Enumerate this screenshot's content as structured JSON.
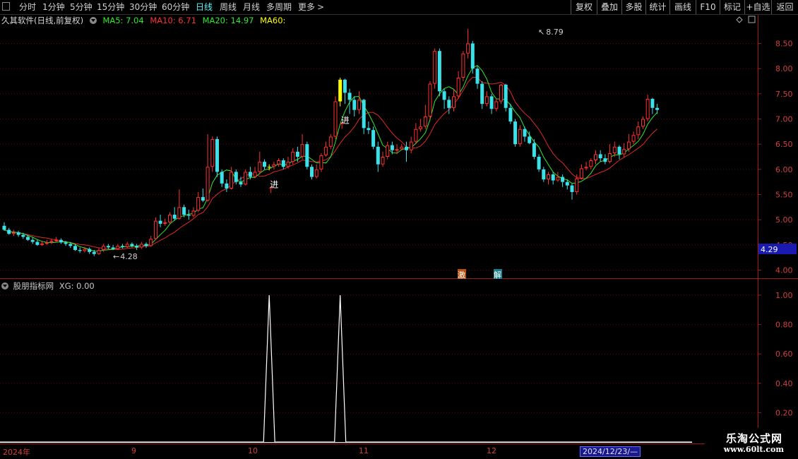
{
  "topbar": {
    "menu_items": [
      "分时",
      "1分钟",
      "5分钟",
      "15分钟",
      "30分钟",
      "60分钟",
      "日线",
      "周线",
      "月线",
      "多周期",
      "更多"
    ],
    "active": "日线",
    "more_arrow": ">",
    "right_buttons": [
      "复权",
      "叠加",
      "多股",
      "统计",
      "画线",
      "F10",
      "标记",
      "+自选",
      "返回"
    ]
  },
  "header": {
    "title": "久其软件(日线,前复权)",
    "ma5": "MA5: 7.04",
    "ma10": "MA10: 6.71",
    "ma20": "MA20: 14.97",
    "ma60": "MA60:",
    "colors": {
      "ma5": "#2ee82e",
      "ma10": "#ff3030",
      "ma20": "#2ee82e",
      "ma60": "#ffff00"
    }
  },
  "indicator": {
    "title": "股朋指标网",
    "value": "XG: 0.00"
  },
  "price_axis": {
    "ticks": [
      "8.50",
      "8.00",
      "7.50",
      "7.00",
      "6.50",
      "6.00",
      "5.50",
      "5.00",
      "4.50",
      "4.00"
    ],
    "current": "4.29"
  },
  "indicator_axis": {
    "ticks": [
      "1.00",
      "0.80",
      "0.60",
      "0.40",
      "0.20"
    ]
  },
  "annotations": {
    "high_label": "8.79",
    "low_label": "4.28",
    "signal_char": "进",
    "event1": "激",
    "event2": "解"
  },
  "time_axis": {
    "labels": [
      "2024年",
      "9",
      "10",
      "11",
      "12"
    ],
    "cursor_date": "2024/12/23/—"
  },
  "watermark": {
    "title": "乐淘公式网",
    "url": "www.60lt.com"
  },
  "chart_data": {
    "type": "candlestick",
    "ylim": [
      3.8,
      8.9
    ],
    "colors": {
      "up": "#ff3030",
      "down": "#3be0e8",
      "signal_bar": "#ffff00"
    },
    "candles": [
      [
        4.88,
        4.8,
        4.95,
        4.78
      ],
      [
        4.8,
        4.72,
        4.84,
        4.7
      ],
      [
        4.72,
        4.75,
        4.8,
        4.68
      ],
      [
        4.75,
        4.7,
        4.78,
        4.66
      ],
      [
        4.7,
        4.66,
        4.74,
        4.62
      ],
      [
        4.66,
        4.6,
        4.7,
        4.58
      ],
      [
        4.6,
        4.56,
        4.65,
        4.52
      ],
      [
        4.56,
        4.5,
        4.6,
        4.48
      ],
      [
        4.5,
        4.53,
        4.57,
        4.48
      ],
      [
        4.53,
        4.55,
        4.6,
        4.5
      ],
      [
        4.55,
        4.58,
        4.62,
        4.52
      ],
      [
        4.58,
        4.6,
        4.66,
        4.55
      ],
      [
        4.6,
        4.55,
        4.63,
        4.52
      ],
      [
        4.55,
        4.52,
        4.58,
        4.48
      ],
      [
        4.52,
        4.48,
        4.56,
        4.44
      ],
      [
        4.48,
        4.4,
        4.52,
        4.38
      ],
      [
        4.4,
        4.38,
        4.45,
        4.34
      ],
      [
        4.38,
        4.42,
        4.46,
        4.35
      ],
      [
        4.42,
        4.36,
        4.45,
        4.32
      ],
      [
        4.36,
        4.32,
        4.4,
        4.28
      ],
      [
        4.32,
        4.4,
        4.44,
        4.3
      ],
      [
        4.4,
        4.48,
        4.52,
        4.36
      ],
      [
        4.48,
        4.45,
        4.52,
        4.42
      ],
      [
        4.45,
        4.42,
        4.5,
        4.4
      ],
      [
        4.42,
        4.48,
        4.52,
        4.4
      ],
      [
        4.48,
        4.46,
        4.52,
        4.43
      ],
      [
        4.46,
        4.52,
        4.56,
        4.44
      ],
      [
        4.52,
        4.48,
        4.55,
        4.45
      ],
      [
        4.48,
        4.45,
        4.52,
        4.4
      ],
      [
        4.45,
        4.52,
        4.56,
        4.42
      ],
      [
        4.52,
        4.48,
        4.55,
        4.44
      ],
      [
        4.48,
        4.62,
        4.68,
        4.46
      ],
      [
        4.62,
        4.98,
        5.05,
        4.6
      ],
      [
        4.98,
        4.92,
        5.1,
        4.85
      ],
      [
        4.92,
        4.95,
        5.02,
        4.88
      ],
      [
        4.95,
        5.1,
        5.15,
        4.92
      ],
      [
        5.1,
        5.02,
        5.25,
        4.98
      ],
      [
        5.02,
        5.25,
        5.6,
        5.0
      ],
      [
        5.25,
        5.1,
        5.3,
        5.05
      ],
      [
        5.1,
        5.08,
        5.2,
        5.0
      ],
      [
        5.08,
        5.18,
        5.25,
        5.05
      ],
      [
        5.18,
        5.45,
        5.55,
        5.15
      ],
      [
        5.45,
        5.38,
        5.62,
        5.35
      ],
      [
        5.38,
        6.05,
        6.7,
        5.35
      ],
      [
        6.05,
        6.6,
        6.65,
        5.95
      ],
      [
        6.6,
        5.95,
        6.65,
        5.85
      ],
      [
        5.95,
        5.72,
        6.0,
        5.65
      ],
      [
        5.72,
        5.62,
        5.8,
        5.55
      ],
      [
        5.62,
        5.95,
        6.05,
        5.6
      ],
      [
        5.95,
        5.75,
        6.0,
        5.7
      ],
      [
        5.75,
        5.7,
        5.85,
        5.65
      ],
      [
        5.7,
        5.95,
        6.0,
        5.68
      ],
      [
        5.95,
        5.85,
        6.05,
        5.8
      ],
      [
        5.85,
        5.95,
        6.05,
        5.82
      ],
      [
        5.95,
        6.15,
        6.35,
        5.9
      ],
      [
        6.15,
        6.05,
        6.2,
        6.0
      ],
      [
        6.05,
        6.05,
        6.1,
        5.98
      ],
      [
        6.05,
        6.1,
        6.15,
        6.0
      ],
      [
        6.1,
        6.18,
        6.22,
        6.05
      ],
      [
        6.18,
        6.05,
        6.22,
        6.0
      ],
      [
        6.05,
        6.15,
        6.25,
        6.02
      ],
      [
        6.15,
        6.35,
        6.42,
        6.1
      ],
      [
        6.35,
        6.25,
        6.45,
        6.15
      ],
      [
        6.25,
        6.5,
        6.7,
        6.2
      ],
      [
        6.5,
        6.05,
        6.55,
        6.0
      ],
      [
        6.05,
        5.85,
        6.1,
        5.8
      ],
      [
        5.85,
        6.0,
        6.1,
        5.82
      ],
      [
        6.0,
        6.28,
        6.32,
        5.95
      ],
      [
        6.28,
        6.45,
        6.55,
        6.25
      ],
      [
        6.45,
        6.65,
        6.7,
        6.4
      ],
      [
        6.65,
        7.35,
        7.45,
        6.6
      ],
      [
        7.35,
        7.78,
        7.82,
        7.25
      ],
      [
        7.78,
        7.52,
        7.8,
        7.3
      ],
      [
        7.52,
        7.38,
        7.6,
        7.1
      ],
      [
        7.38,
        7.18,
        7.45,
        7.05
      ],
      [
        7.18,
        7.38,
        7.55,
        7.1
      ],
      [
        7.38,
        6.82,
        7.4,
        6.7
      ],
      [
        6.82,
        6.78,
        6.95,
        6.7
      ],
      [
        6.78,
        6.45,
        6.85,
        6.4
      ],
      [
        6.45,
        6.1,
        6.55,
        5.95
      ],
      [
        6.1,
        6.25,
        6.35,
        6.05
      ],
      [
        6.25,
        6.48,
        6.55,
        6.2
      ],
      [
        6.48,
        6.38,
        6.55,
        6.3
      ],
      [
        6.38,
        6.4,
        6.5,
        6.3
      ],
      [
        6.4,
        6.45,
        6.5,
        6.38
      ],
      [
        6.45,
        6.38,
        6.55,
        6.15
      ],
      [
        6.38,
        6.55,
        6.65,
        6.32
      ],
      [
        6.55,
        6.8,
        6.92,
        6.5
      ],
      [
        6.8,
        6.85,
        7.0,
        6.75
      ],
      [
        6.85,
        7.05,
        7.28,
        6.8
      ],
      [
        7.05,
        7.7,
        7.75,
        7.0
      ],
      [
        7.7,
        8.35,
        8.4,
        7.6
      ],
      [
        8.35,
        7.55,
        8.4,
        7.45
      ],
      [
        7.55,
        7.38,
        7.6,
        7.2
      ],
      [
        7.38,
        7.22,
        7.45,
        7.1
      ],
      [
        7.22,
        7.45,
        7.6,
        7.15
      ],
      [
        7.45,
        7.82,
        7.95,
        7.4
      ],
      [
        7.82,
        8.3,
        8.35,
        7.75
      ],
      [
        8.3,
        8.5,
        8.79,
        8.2
      ],
      [
        8.5,
        8.0,
        8.55,
        7.9
      ],
      [
        8.0,
        7.7,
        8.05,
        7.6
      ],
      [
        7.7,
        7.3,
        7.75,
        7.2
      ],
      [
        7.3,
        7.45,
        7.55,
        7.25
      ],
      [
        7.45,
        7.2,
        7.5,
        7.1
      ],
      [
        7.2,
        7.35,
        7.4,
        7.15
      ],
      [
        7.35,
        7.68,
        7.7,
        7.3
      ],
      [
        7.68,
        7.22,
        7.7,
        7.15
      ],
      [
        7.22,
        6.95,
        7.3,
        6.9
      ],
      [
        6.95,
        6.5,
        7.0,
        6.45
      ],
      [
        6.5,
        6.8,
        6.88,
        6.45
      ],
      [
        6.8,
        6.65,
        6.85,
        6.55
      ],
      [
        6.65,
        6.52,
        6.75,
        6.5
      ],
      [
        6.52,
        6.25,
        6.6,
        6.2
      ],
      [
        6.25,
        6.0,
        6.3,
        5.95
      ],
      [
        6.0,
        5.8,
        6.05,
        5.75
      ],
      [
        5.8,
        5.9,
        5.95,
        5.7
      ],
      [
        5.9,
        5.78,
        5.95,
        5.7
      ],
      [
        5.78,
        5.85,
        5.95,
        5.75
      ],
      [
        5.85,
        5.75,
        5.9,
        5.65
      ],
      [
        5.75,
        5.68,
        5.8,
        5.6
      ],
      [
        5.68,
        5.55,
        5.72,
        5.4
      ],
      [
        5.55,
        5.82,
        5.9,
        5.5
      ],
      [
        5.82,
        6.02,
        6.1,
        5.8
      ],
      [
        6.02,
        6.05,
        6.15,
        5.98
      ],
      [
        6.05,
        6.18,
        6.22,
        6.0
      ],
      [
        6.18,
        6.3,
        6.38,
        6.1
      ],
      [
        6.3,
        6.22,
        6.38,
        6.15
      ],
      [
        6.22,
        6.15,
        6.3,
        6.1
      ],
      [
        6.15,
        6.32,
        6.5,
        6.12
      ],
      [
        6.32,
        6.45,
        6.55,
        6.25
      ],
      [
        6.45,
        6.3,
        6.48,
        6.2
      ],
      [
        6.3,
        6.4,
        6.52,
        6.25
      ],
      [
        6.4,
        6.55,
        6.7,
        6.35
      ],
      [
        6.55,
        6.68,
        6.75,
        6.5
      ],
      [
        6.68,
        6.85,
        6.95,
        6.6
      ],
      [
        6.85,
        7.0,
        7.05,
        6.8
      ],
      [
        7.0,
        7.4,
        7.48,
        6.95
      ],
      [
        7.4,
        7.22,
        7.42,
        7.1
      ],
      [
        7.22,
        7.18,
        7.3,
        7.1
      ]
    ],
    "signal_bars": [
      56,
      71
    ],
    "signal_days": [
      56,
      71
    ],
    "indicator_series": [
      0
    ]
  }
}
